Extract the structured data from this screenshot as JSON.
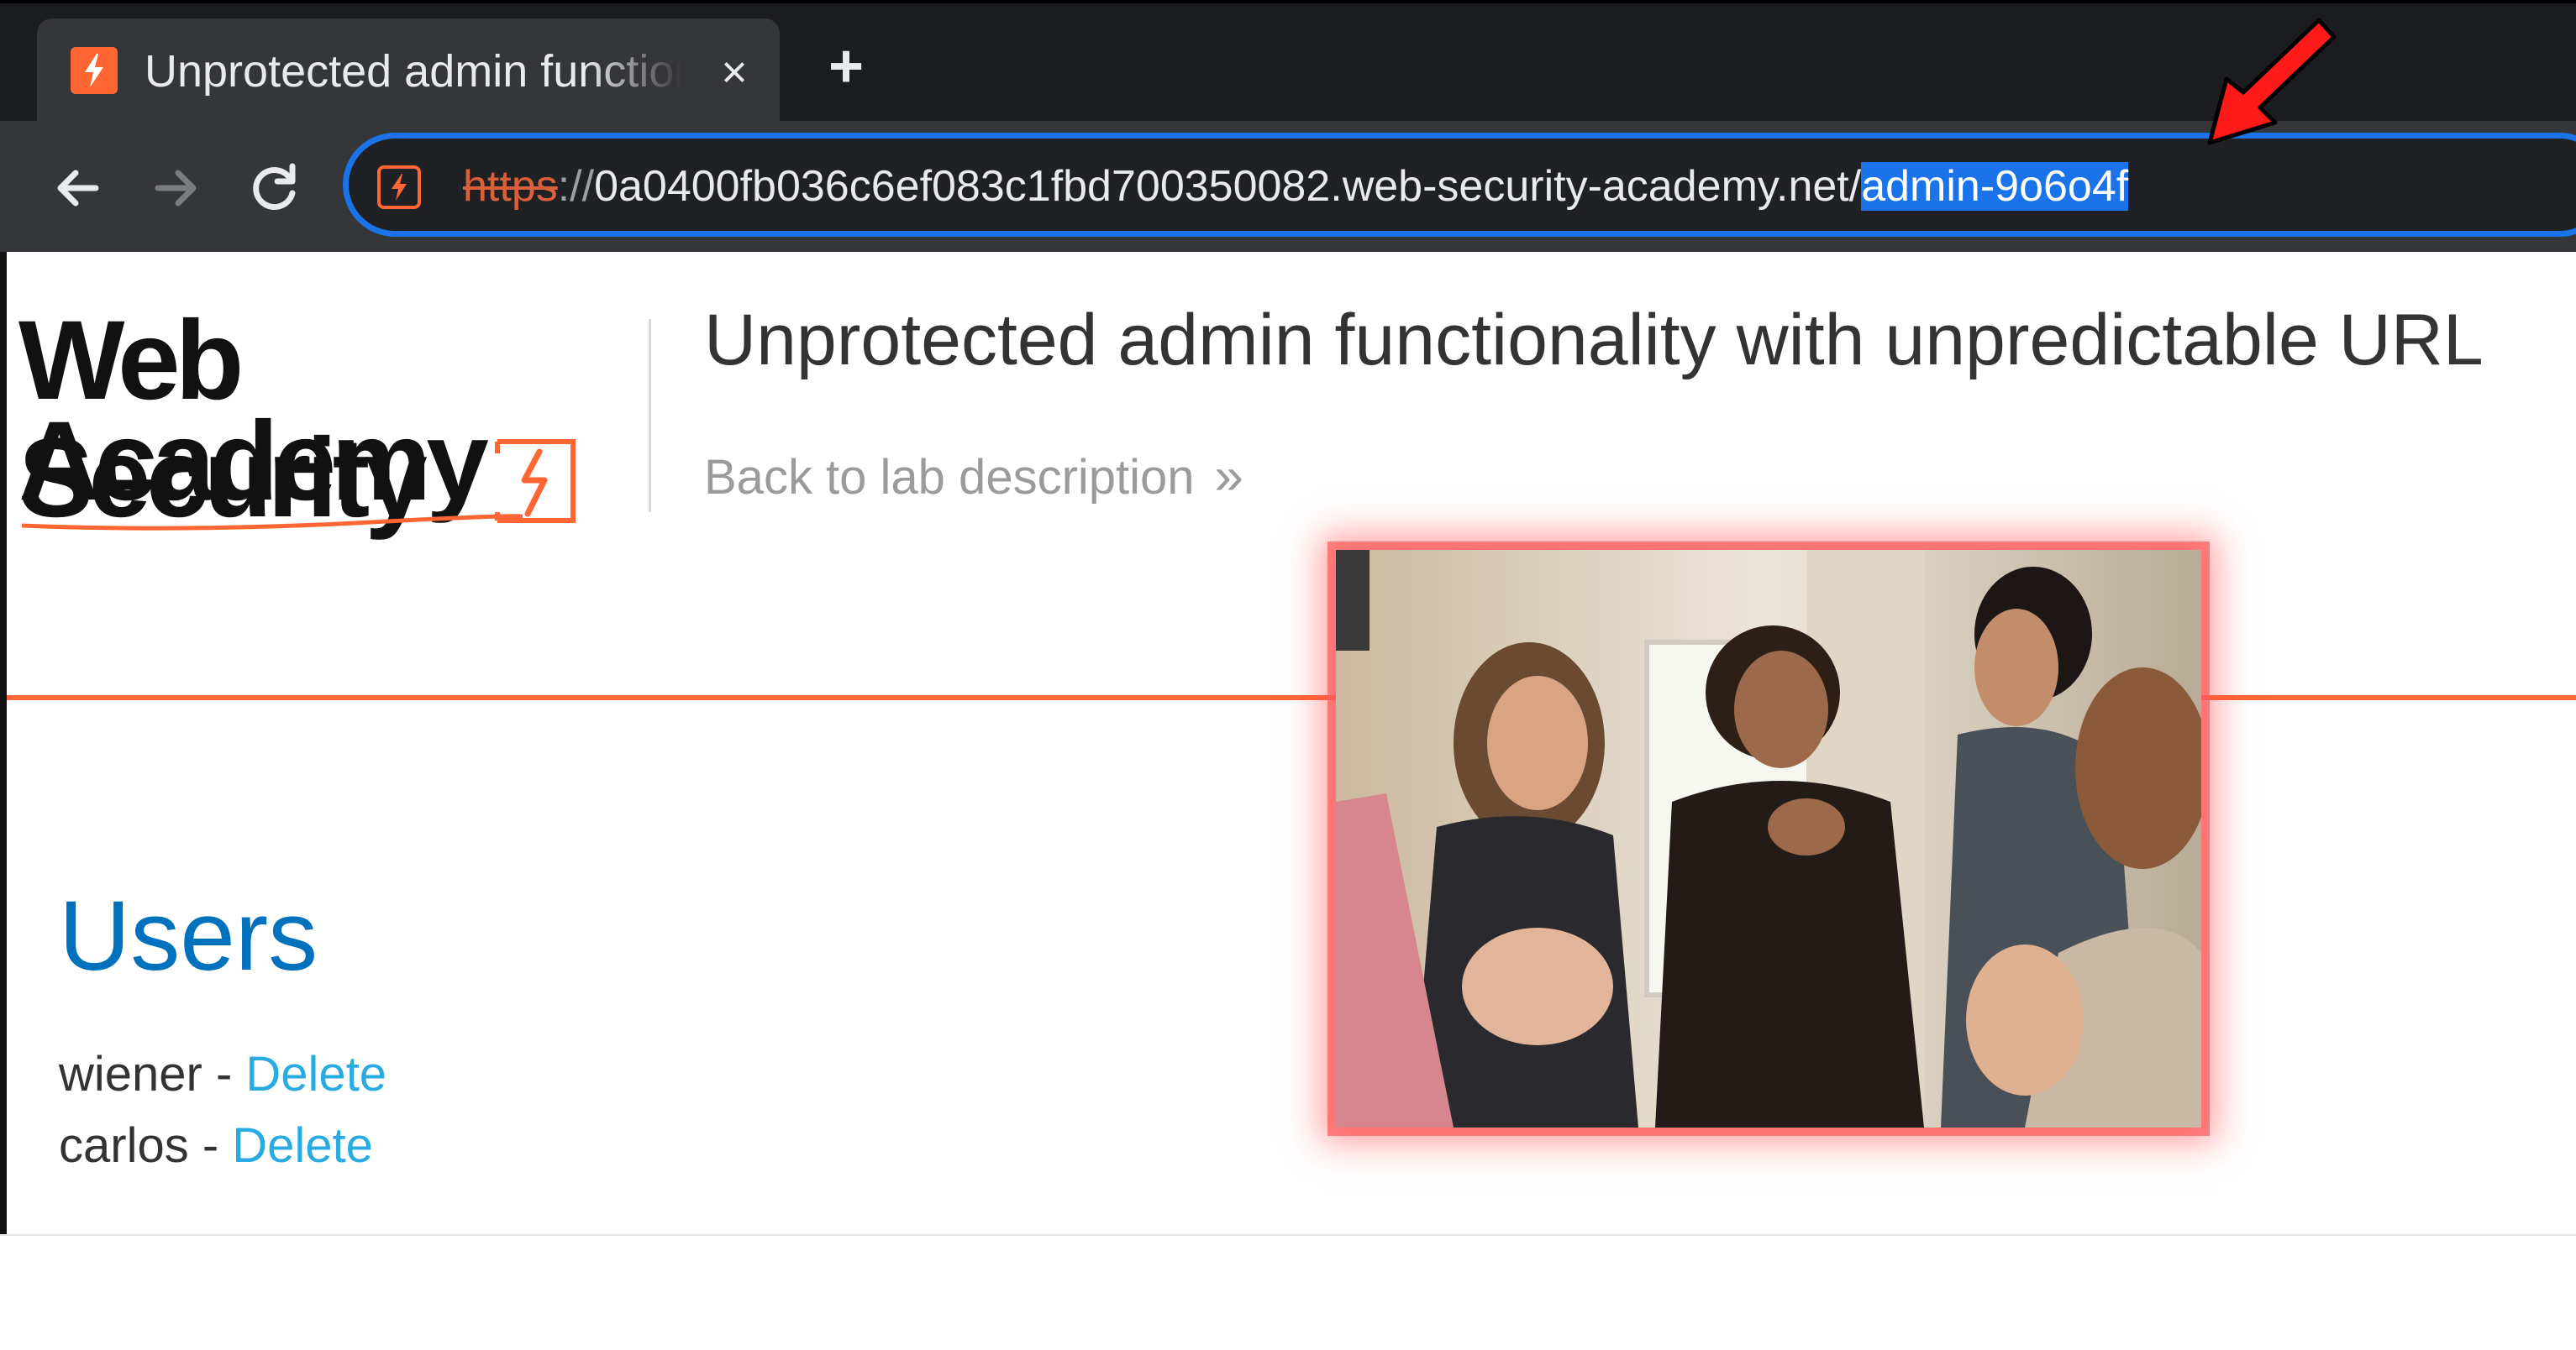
{
  "browser": {
    "tab": {
      "title": "Unprotected admin functionality with unpredictable URL",
      "close_glyph": "×",
      "favicon": "lightning-icon"
    },
    "new_tab_glyph": "+",
    "toolbar": {
      "back_icon": "back-arrow-icon",
      "forward_icon": "forward-arrow-icon",
      "reload_icon": "reload-icon"
    },
    "address_bar": {
      "scheme": "https",
      "separator": "://",
      "host": "0a0400fb036c6ef083c1fbd700350082.web-security-academy.net/",
      "path_selected": "admin-9o6o4f"
    }
  },
  "page": {
    "logo": {
      "line1": "Web Security",
      "line2": "Academy"
    },
    "lab_title": "Unprotected admin functionality with unpredictable URL",
    "back_link": "Back to lab description",
    "back_link_chevrons": "»",
    "users_heading": "Users",
    "users": [
      {
        "name": "wiener",
        "separator": " - ",
        "action": "Delete"
      },
      {
        "name": "carlos",
        "separator": " - ",
        "action": "Delete"
      }
    ]
  },
  "colors": {
    "accent_orange": "#ff6633",
    "link_blue": "#29abe2",
    "heading_blue": "#0071bc",
    "omnibox_focus": "#1a73e8",
    "annotation_red": "#ff1a1a"
  }
}
